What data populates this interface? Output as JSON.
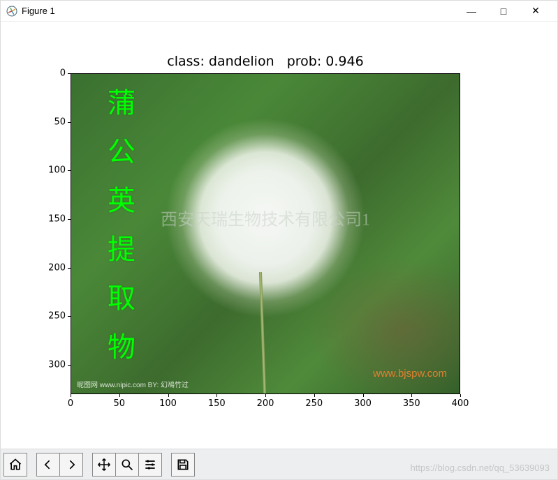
{
  "window": {
    "title": "Figure 1",
    "buttons": {
      "min": "—",
      "max": "□",
      "close": "✕"
    }
  },
  "chart_data": {
    "type": "image",
    "title": "class: dandelion   prob: 0.946",
    "xlim": [
      0,
      400
    ],
    "ylim": [
      330,
      0
    ],
    "xticks": [
      0,
      50,
      100,
      150,
      200,
      250,
      300,
      350,
      400
    ],
    "yticks": [
      0,
      50,
      100,
      150,
      200,
      250,
      300
    ],
    "overlays": {
      "cn_vertical": "蒲公英提取物",
      "center_watermark": "西安天瑞生物技术有限公司1",
      "url_watermark": "www.bjspw.com",
      "bottom_left": "昵图网 www.nipic.com   BY: 幻鳰竹过"
    }
  },
  "toolbar": {
    "home": "Home",
    "back": "Back",
    "forward": "Forward",
    "pan": "Pan",
    "zoom": "Zoom",
    "configure": "Configure subplots",
    "save": "Save"
  },
  "footer_watermark": "https://blog.csdn.net/qq_53639093"
}
